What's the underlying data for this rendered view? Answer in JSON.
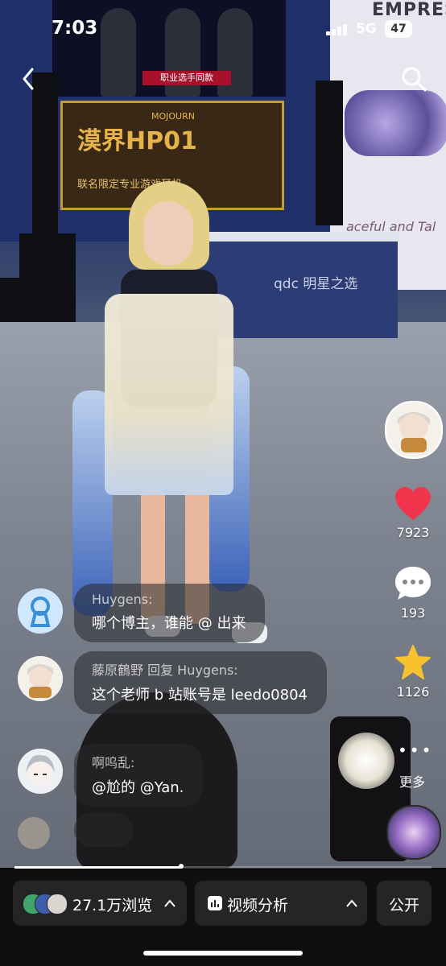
{
  "status_bar": {
    "time": "7:03",
    "network": "5G",
    "battery": "47"
  },
  "scene": {
    "banner": "职业选手同款",
    "poster_title": "漠界HP01",
    "poster_sub": "MOJOURN",
    "poster_tagline": "联名限定专业游戏耳机",
    "brand": "EMPRES",
    "slogan": "aceful and Tal",
    "stage_logo": "qdc 明星之选"
  },
  "actions": {
    "likes": "7923",
    "comments": "193",
    "favorites": "1126",
    "more_label": "更多"
  },
  "comments": [
    {
      "user": "Huygens:",
      "text": "哪个博主，谁能 @ 出来"
    },
    {
      "user": "藤原鶴野 回复 Huygens:",
      "text": "这个老师 b 站账号是 leedo0804"
    },
    {
      "user": "啊呜乱:",
      "text": "@尬的 @Yan."
    },
    {
      "user": "",
      "text": ""
    }
  ],
  "progress": {
    "fraction": 0.4
  },
  "bottom_bar": {
    "views": "27.1万浏览",
    "analysis": "视频分析",
    "visibility": "公开"
  },
  "colors": {
    "like": "#f0354d",
    "favorite": "#f7c22e",
    "bar_bg": "#0f0f10",
    "pill_bg": "#252527"
  }
}
